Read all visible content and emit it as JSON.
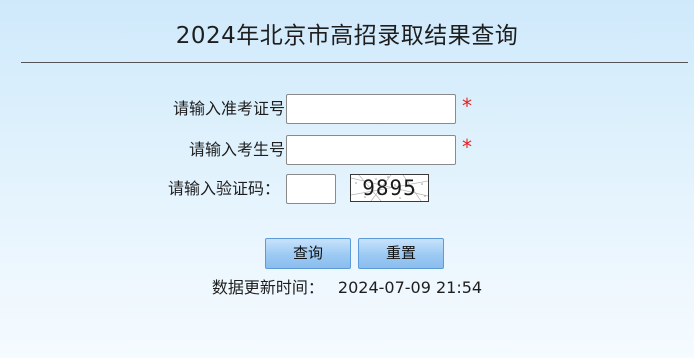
{
  "header": {
    "title": "2024年北京市高招录取结果查询"
  },
  "form": {
    "exam_id": {
      "label": "请输入准考证号",
      "value": "",
      "required_mark": "*"
    },
    "student_id": {
      "label": "请输入考生号",
      "value": "",
      "required_mark": "*"
    },
    "captcha": {
      "label": "请输入验证码：",
      "value": "",
      "image_text": "9895"
    }
  },
  "buttons": {
    "query_label": "查询",
    "reset_label": "重置"
  },
  "footer": {
    "update_label": "数据更新时间：",
    "update_time": "2024-07-09 21:54"
  },
  "colors": {
    "background_top": "#cfe9fb",
    "background_bottom": "#f5fbff",
    "required_mark": "#e8201d",
    "button_fill": "#9ccaf3",
    "button_border": "#5d9ad8"
  },
  "icons": {
    "captcha": "captcha-image"
  }
}
